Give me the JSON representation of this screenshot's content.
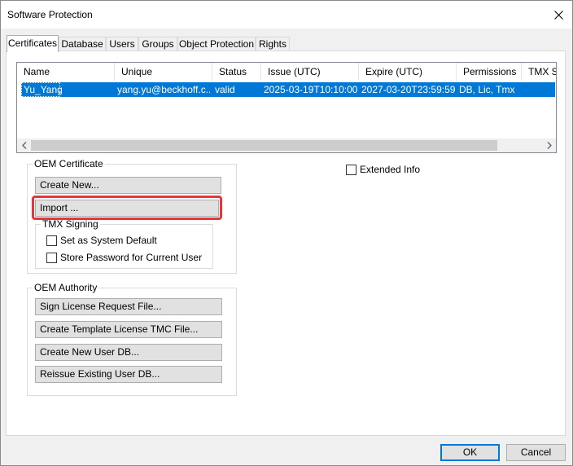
{
  "window": {
    "title": "Software Protection"
  },
  "tabs": [
    {
      "label": "Certificates",
      "active": true
    },
    {
      "label": "Database"
    },
    {
      "label": "Users"
    },
    {
      "label": "Groups"
    },
    {
      "label": "Object Protection"
    },
    {
      "label": "Rights"
    }
  ],
  "certificates": {
    "columns": [
      "Name",
      "Unique",
      "Status",
      "Issue (UTC)",
      "Expire (UTC)",
      "Permissions",
      "TMX S"
    ],
    "rows": [
      [
        "Yu_Yang",
        "yang.yu@beckhoff.c...",
        "valid",
        "2025-03-19T10:10:00",
        "2027-03-20T23:59:59",
        "DB, Lic, Tmx",
        ""
      ]
    ]
  },
  "oem_certificate": {
    "title": "OEM Certificate",
    "create_new_label": "Create New...",
    "import_label": "Import ...",
    "tmx_signing": {
      "title": "TMX Signing",
      "set_default_label": "Set as System Default",
      "store_password_label": "Store Password for Current User"
    }
  },
  "extended_info_label": "Extended Info",
  "oem_authority": {
    "title": "OEM Authority",
    "buttons": [
      "Sign License Request File...",
      "Create Template License TMC File...",
      "Create New User DB...",
      "Reissue Existing User DB..."
    ]
  },
  "footer": {
    "ok_label": "OK",
    "cancel_label": "Cancel"
  },
  "colors": {
    "selection": "#0078d7",
    "highlight_border": "#e8353a"
  }
}
